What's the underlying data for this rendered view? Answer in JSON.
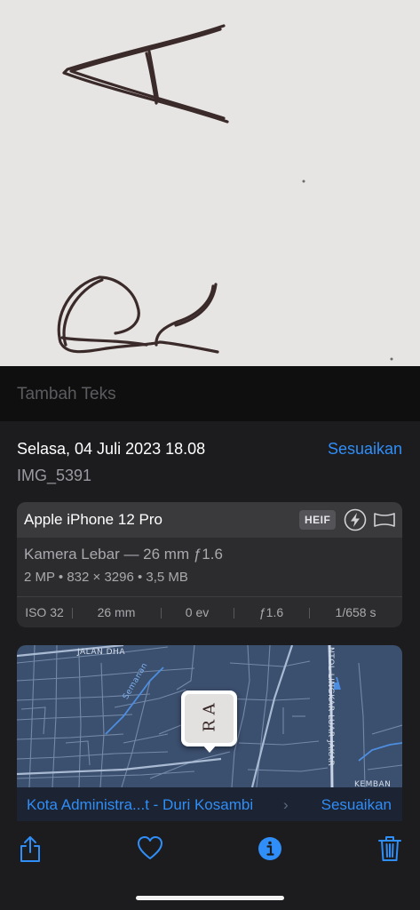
{
  "caption": {
    "placeholder": "Tambah Teks"
  },
  "info": {
    "date": "Selasa, 04 Juli 2023 18.08",
    "adjust_label": "Sesuaikan",
    "filename": "IMG_5391"
  },
  "camera": {
    "device": "Apple iPhone 12 Pro",
    "format_badge": "HEIF",
    "lens": "Kamera Lebar — 26 mm ƒ1.6",
    "specs": "2 MP  •  832 × 3296  •  3,5 MB",
    "exif": [
      "ISO 32",
      "26 mm",
      "0 ev",
      "ƒ1.6",
      "1/658 s"
    ],
    "icons": [
      "flash-icon",
      "panorama-icon"
    ]
  },
  "map": {
    "street_labels": [
      "JALAN DHA",
      "Semanan",
      "NTOL LINGKAR LUAR JAKAR",
      "KEMBAN"
    ],
    "thumbnail_text": "R A",
    "location": "Kota Administra...t - Duri Kosambi",
    "chevron": "›",
    "adjust_label": "Sesuaikan"
  },
  "toolbar": {
    "icons": [
      "share-icon",
      "favorite-heart-icon",
      "info-icon",
      "trash-icon"
    ]
  },
  "colors": {
    "accent": "#2f8ef7",
    "background": "#000000",
    "panel": "#1c1c1e",
    "card": "#2c2c2e"
  }
}
